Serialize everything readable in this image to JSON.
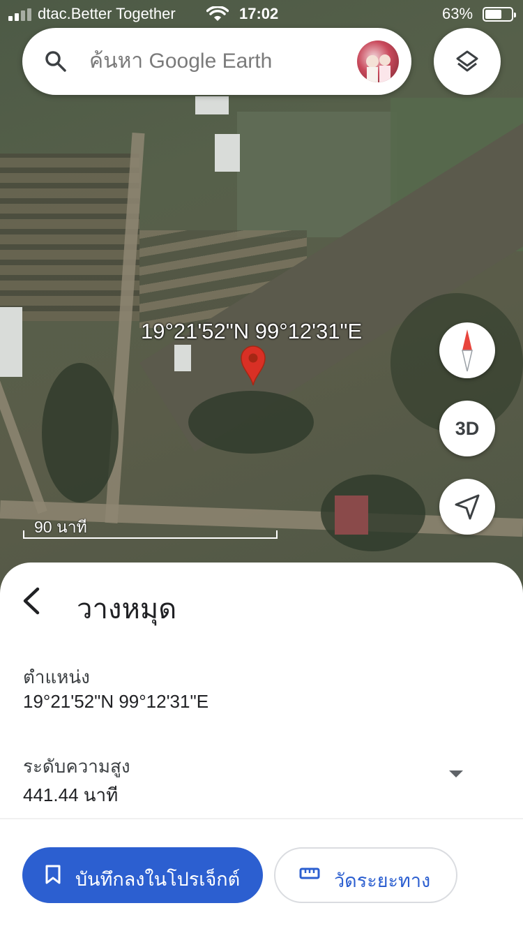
{
  "status_bar": {
    "carrier": "dtac.Better Together",
    "time": "17:02",
    "battery_percent": "63%",
    "battery_level": 0.63
  },
  "search": {
    "placeholder": "ค้นหา Google Earth",
    "icon": "search-icon"
  },
  "map": {
    "pin_coordinates": "19°21'52\"N 99°12'31\"E",
    "scale_label": "90 นาที",
    "buttons": {
      "compass_icon": "compass-icon",
      "three_d_label": "3D",
      "locate_icon": "navigation-arrow-icon",
      "layers_icon": "layers-icon"
    }
  },
  "sheet": {
    "title": "วางหมุด",
    "location_label": "ตำแหน่ง",
    "location_value": "19°21'52\"N 99°12'31\"E",
    "altitude_label": "ระดับความสูง",
    "altitude_value": "441.44 นาที",
    "save_button": "บันทึกลงในโปรเจ็กต์",
    "measure_button": "วัดระยะทาง"
  },
  "colors": {
    "accent": "#2c5fd0",
    "pin": "#d93025"
  }
}
